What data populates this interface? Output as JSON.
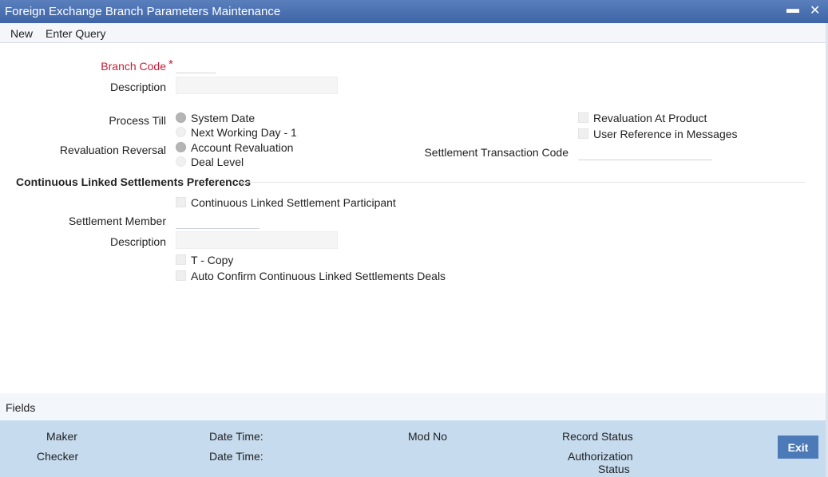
{
  "window": {
    "title": "Foreign Exchange Branch Parameters Maintenance",
    "minimize_glyph": "▬",
    "close_glyph": "✕"
  },
  "menu": {
    "new": "New",
    "enter_query": "Enter Query"
  },
  "form": {
    "branch_code_label": "Branch Code",
    "required_marker": "*",
    "description_label": "Description",
    "process_till_label": "Process Till",
    "process_till_options": [
      "System Date",
      "Next Working Day - 1"
    ],
    "revaluation_reversal_label": "Revaluation Reversal",
    "revaluation_reversal_options": [
      "Account Revaluation",
      "Deal Level"
    ],
    "revaluation_at_product": "Revaluation At Product",
    "user_reference_in_messages": "User Reference in Messages",
    "settlement_transaction_code_label": "Settlement Transaction Code"
  },
  "cls": {
    "section_title": "Continuous Linked Settlements Preferences",
    "participant": "Continuous Linked Settlement Participant",
    "settlement_member_label": "Settlement Member",
    "description_label": "Description",
    "t_copy": "T - Copy",
    "auto_confirm": "Auto Confirm Continuous Linked Settlements Deals"
  },
  "fields_bar": {
    "label": "Fields"
  },
  "footer": {
    "maker": "Maker",
    "checker": "Checker",
    "date_time_1": "Date Time:",
    "date_time_2": "Date Time:",
    "mod_no": "Mod No",
    "record_status": "Record Status",
    "authorization": "Authorization",
    "status": "Status",
    "exit": "Exit"
  }
}
